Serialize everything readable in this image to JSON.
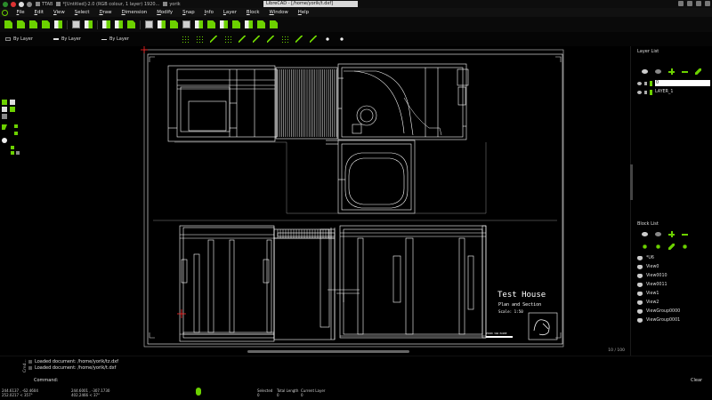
{
  "os_panel": {
    "tasks": [
      {
        "label": "TTAB"
      },
      {
        "label": "*[Untitled]-2.0 (RGB colour, 1 layer) 1920..."
      },
      {
        "label": "yorik"
      }
    ],
    "window_title": "LibreCAD - [/home/yorik/t.dxf]"
  },
  "menubar": {
    "items": [
      "File",
      "Edit",
      "View",
      "Select",
      "Draw",
      "Dimension",
      "Modify",
      "Snap",
      "Info",
      "Layer",
      "Block",
      "Window",
      "Help"
    ]
  },
  "pen_toolbar": {
    "color": "By Layer",
    "width": "By Layer",
    "linetype": "By Layer"
  },
  "drawing": {
    "title": "Test House",
    "subtitle": "Plan and Section",
    "scale": "Scale: 1:50",
    "small_note": "YORIK VAN HAVRE",
    "zoom_readout": "10 / 100"
  },
  "layer_list": {
    "title": "Layer List",
    "layers": [
      {
        "name": "0",
        "selected": true
      },
      {
        "name": "LAYER_1",
        "selected": false
      }
    ]
  },
  "block_list": {
    "title": "Block List",
    "blocks": [
      "*U6",
      "View0",
      "View0010",
      "View0011",
      "View1",
      "View2",
      "ViewGroup0000",
      "ViewGroup0001"
    ]
  },
  "command_area": {
    "history": [
      "Loaded document: /home/yorik/tz.dxf",
      "Loaded document: /home/yorik/t.dxf"
    ],
    "label": "Command:",
    "side_label": "Cmd...",
    "clear_label": "Clear"
  },
  "statusbar": {
    "abs_coord_1": "244.6137 , -62.4604",
    "abs_coord_2": "252.0217 < 357°",
    "rel_coord_1": "244.6001 , -307.1730",
    "rel_coord_2": "402.2466 < 37°",
    "selected_label": "Selected",
    "selected_value": "0",
    "length_label": "Total Length",
    "length_value": "0",
    "layer_label": "Current Layer",
    "layer_value": "0"
  },
  "colors": {
    "accent": "#6cd100",
    "background": "#000000",
    "cad_lines": "#ffffff"
  }
}
